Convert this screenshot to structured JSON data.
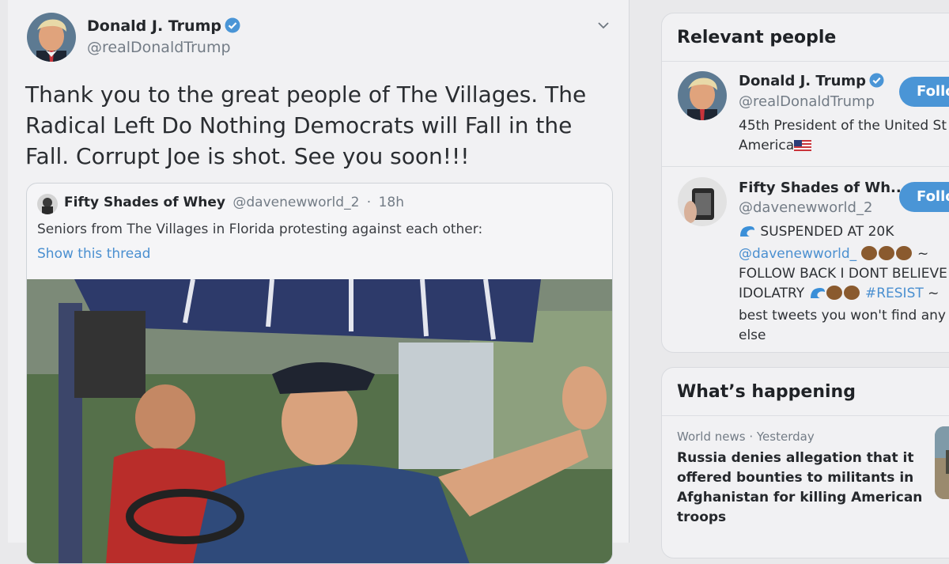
{
  "tweet": {
    "author_name": "Donald J. Trump",
    "author_handle": "@realDonaldTrump",
    "text": "Thank you to the great people of The Villages. The Radical Left Do Nothing Democrats will Fall in the Fall. Corrupt Joe is shot. See you soon!!!",
    "quoted": {
      "author_name": "Fifty Shades of Whey",
      "author_handle": "@davenewworld_2",
      "separator": "·",
      "time": "18h",
      "text": "Seniors from The Villages in Florida protesting against each other:",
      "show_thread": "Show this thread"
    }
  },
  "sidebar": {
    "relevant_people": {
      "title": "Relevant people",
      "people": [
        {
          "name": "Donald J. Trump",
          "handle": "@realDonaldTrump",
          "bio_line1": "45th President of the United St",
          "bio_line2": "America",
          "follow_label": "Follo"
        },
        {
          "name": "Fifty Shades of Wh...",
          "handle": "@davenewworld_2",
          "bio_line1": "SUSPENDED AT 20K",
          "bio_line2_link": "@davenewworld_",
          "bio_line2_suffix": "~",
          "bio_line3": "FOLLOW BACK I DONT BELIEVE",
          "bio_line4_text": "IDOLATRY",
          "bio_line4_tag": "#RESIST",
          "bio_line4_suffix": "~",
          "bio_line5": "best tweets you won't find any",
          "bio_line6": "else",
          "follow_label": "Follo"
        }
      ]
    },
    "whats_happening": {
      "title": "What’s happening",
      "items": [
        {
          "meta": "World news · Yesterday",
          "title": "Russia denies allegation that it offered bounties to militants in Afghanistan for killing American troops"
        }
      ]
    }
  },
  "colors": {
    "accent": "#4a95d6",
    "link": "#4a8fd0",
    "muted_text": "#737c86"
  }
}
